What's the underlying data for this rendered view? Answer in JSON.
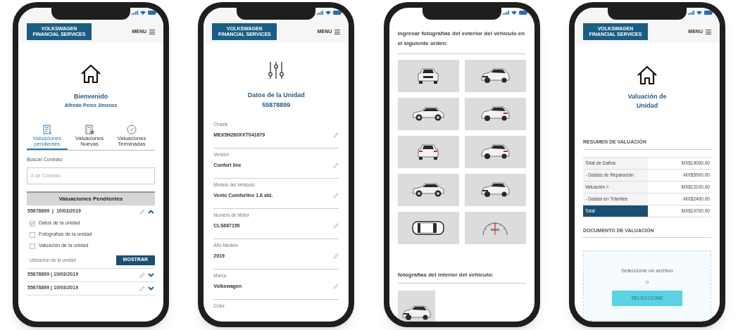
{
  "phones": [
    {
      "kind": "home",
      "header": {
        "logo": [
          "VOLKSWAGEN",
          "FINANCIAL SERVICES"
        ],
        "menu": "MENU"
      },
      "title": "Bienvenido",
      "subtitle": "Alfredo Perez Jimenez",
      "tabs": [
        {
          "label": "Valuaciones pendientes",
          "selected": true
        },
        {
          "label": "Valuaciones Nuevas",
          "selected": false
        },
        {
          "label": "Valuaciones Terminadas",
          "selected": false
        }
      ],
      "search": {
        "label": "Buscar Contrato",
        "placeholder": "# de Contrato"
      },
      "section": "Valuaciones Pendientes",
      "contracts": [
        {
          "number": "55678899  |  10/03/2019",
          "expanded": true,
          "tasks": [
            {
              "label": "Datos de la unidad",
              "checked": true
            },
            {
              "label": "Fotografías de la unidad",
              "checked": false
            },
            {
              "label": "Valuación de la unidad",
              "checked": false
            }
          ],
          "location": "Ubicación de la unidad",
          "button": "MOSTRAR"
        },
        {
          "number": "55678899 | 10/03/2019",
          "expanded": false
        },
        {
          "number": "55678899 | 10/03/2019",
          "expanded": false
        }
      ]
    },
    {
      "kind": "details",
      "header": {
        "logo": [
          "VOLKSWAGEN",
          "FINANCIAL SERVICES"
        ],
        "menu": "MENU"
      },
      "title": "Datos de la Unidad",
      "subtitle": "55878899",
      "fields": [
        {
          "label": "Chasis",
          "value": "MEX5H260XXT041679"
        },
        {
          "label": "Versión",
          "value": "Confort line"
        },
        {
          "label": "Modelo del Vehiculo",
          "value": "Vento Comforline 1.6 std."
        },
        {
          "label": "Numero de Motor",
          "value": "CLS687150"
        },
        {
          "label": "Año Modelo",
          "value": "2019"
        },
        {
          "label": "Marca",
          "value": "Volkswagen"
        },
        {
          "label": "Color"
        }
      ]
    },
    {
      "kind": "photos",
      "heading": "ingresar fotografías del exterior del vehiculo en el siguiente orden:",
      "tiles": [
        {
          "kind": "front"
        },
        {
          "kind": "angled"
        },
        {
          "kind": "side"
        },
        {
          "kind": "angledrear"
        },
        {
          "kind": "rear"
        },
        {
          "kind": "angledrear"
        },
        {
          "kind": "side"
        },
        {
          "kind": "angled"
        },
        {
          "kind": "top"
        },
        {
          "kind": "gauge"
        }
      ],
      "interior_heading": "fotografías del interior del vehiculo:",
      "interior_tiles": [
        {
          "kind": "angled"
        }
      ]
    },
    {
      "kind": "valuation",
      "header": {
        "logo": [
          "VOLKSWAGEN",
          "FINANCIAL SERVICES"
        ],
        "menu": "MENU"
      },
      "title": "Valuación de Unidad",
      "summary_heading": "RESUMEN DE VALUACIÓN",
      "rows": [
        {
          "label": "Total de Daños",
          "amount": "MX$19000.00",
          "highlight": false
        },
        {
          "label": "- Gastos de Reparación",
          "amount": "-MX$5900.00",
          "highlight": false
        },
        {
          "label": "Valuación =",
          "amount": "MX$13100.00",
          "highlight": false
        },
        {
          "label": "- Gastos en Trámites",
          "amount": "-MX$2400.00",
          "highlight": false
        },
        {
          "label": "Total",
          "amount": "MX$10700.00",
          "highlight": true
        }
      ],
      "document_heading": "DOCUMENTO DE VALUACIÓN",
      "upload": {
        "text": "Seleccione un archivo",
        "or": "o",
        "button": "SELECCIONE"
      }
    }
  ]
}
